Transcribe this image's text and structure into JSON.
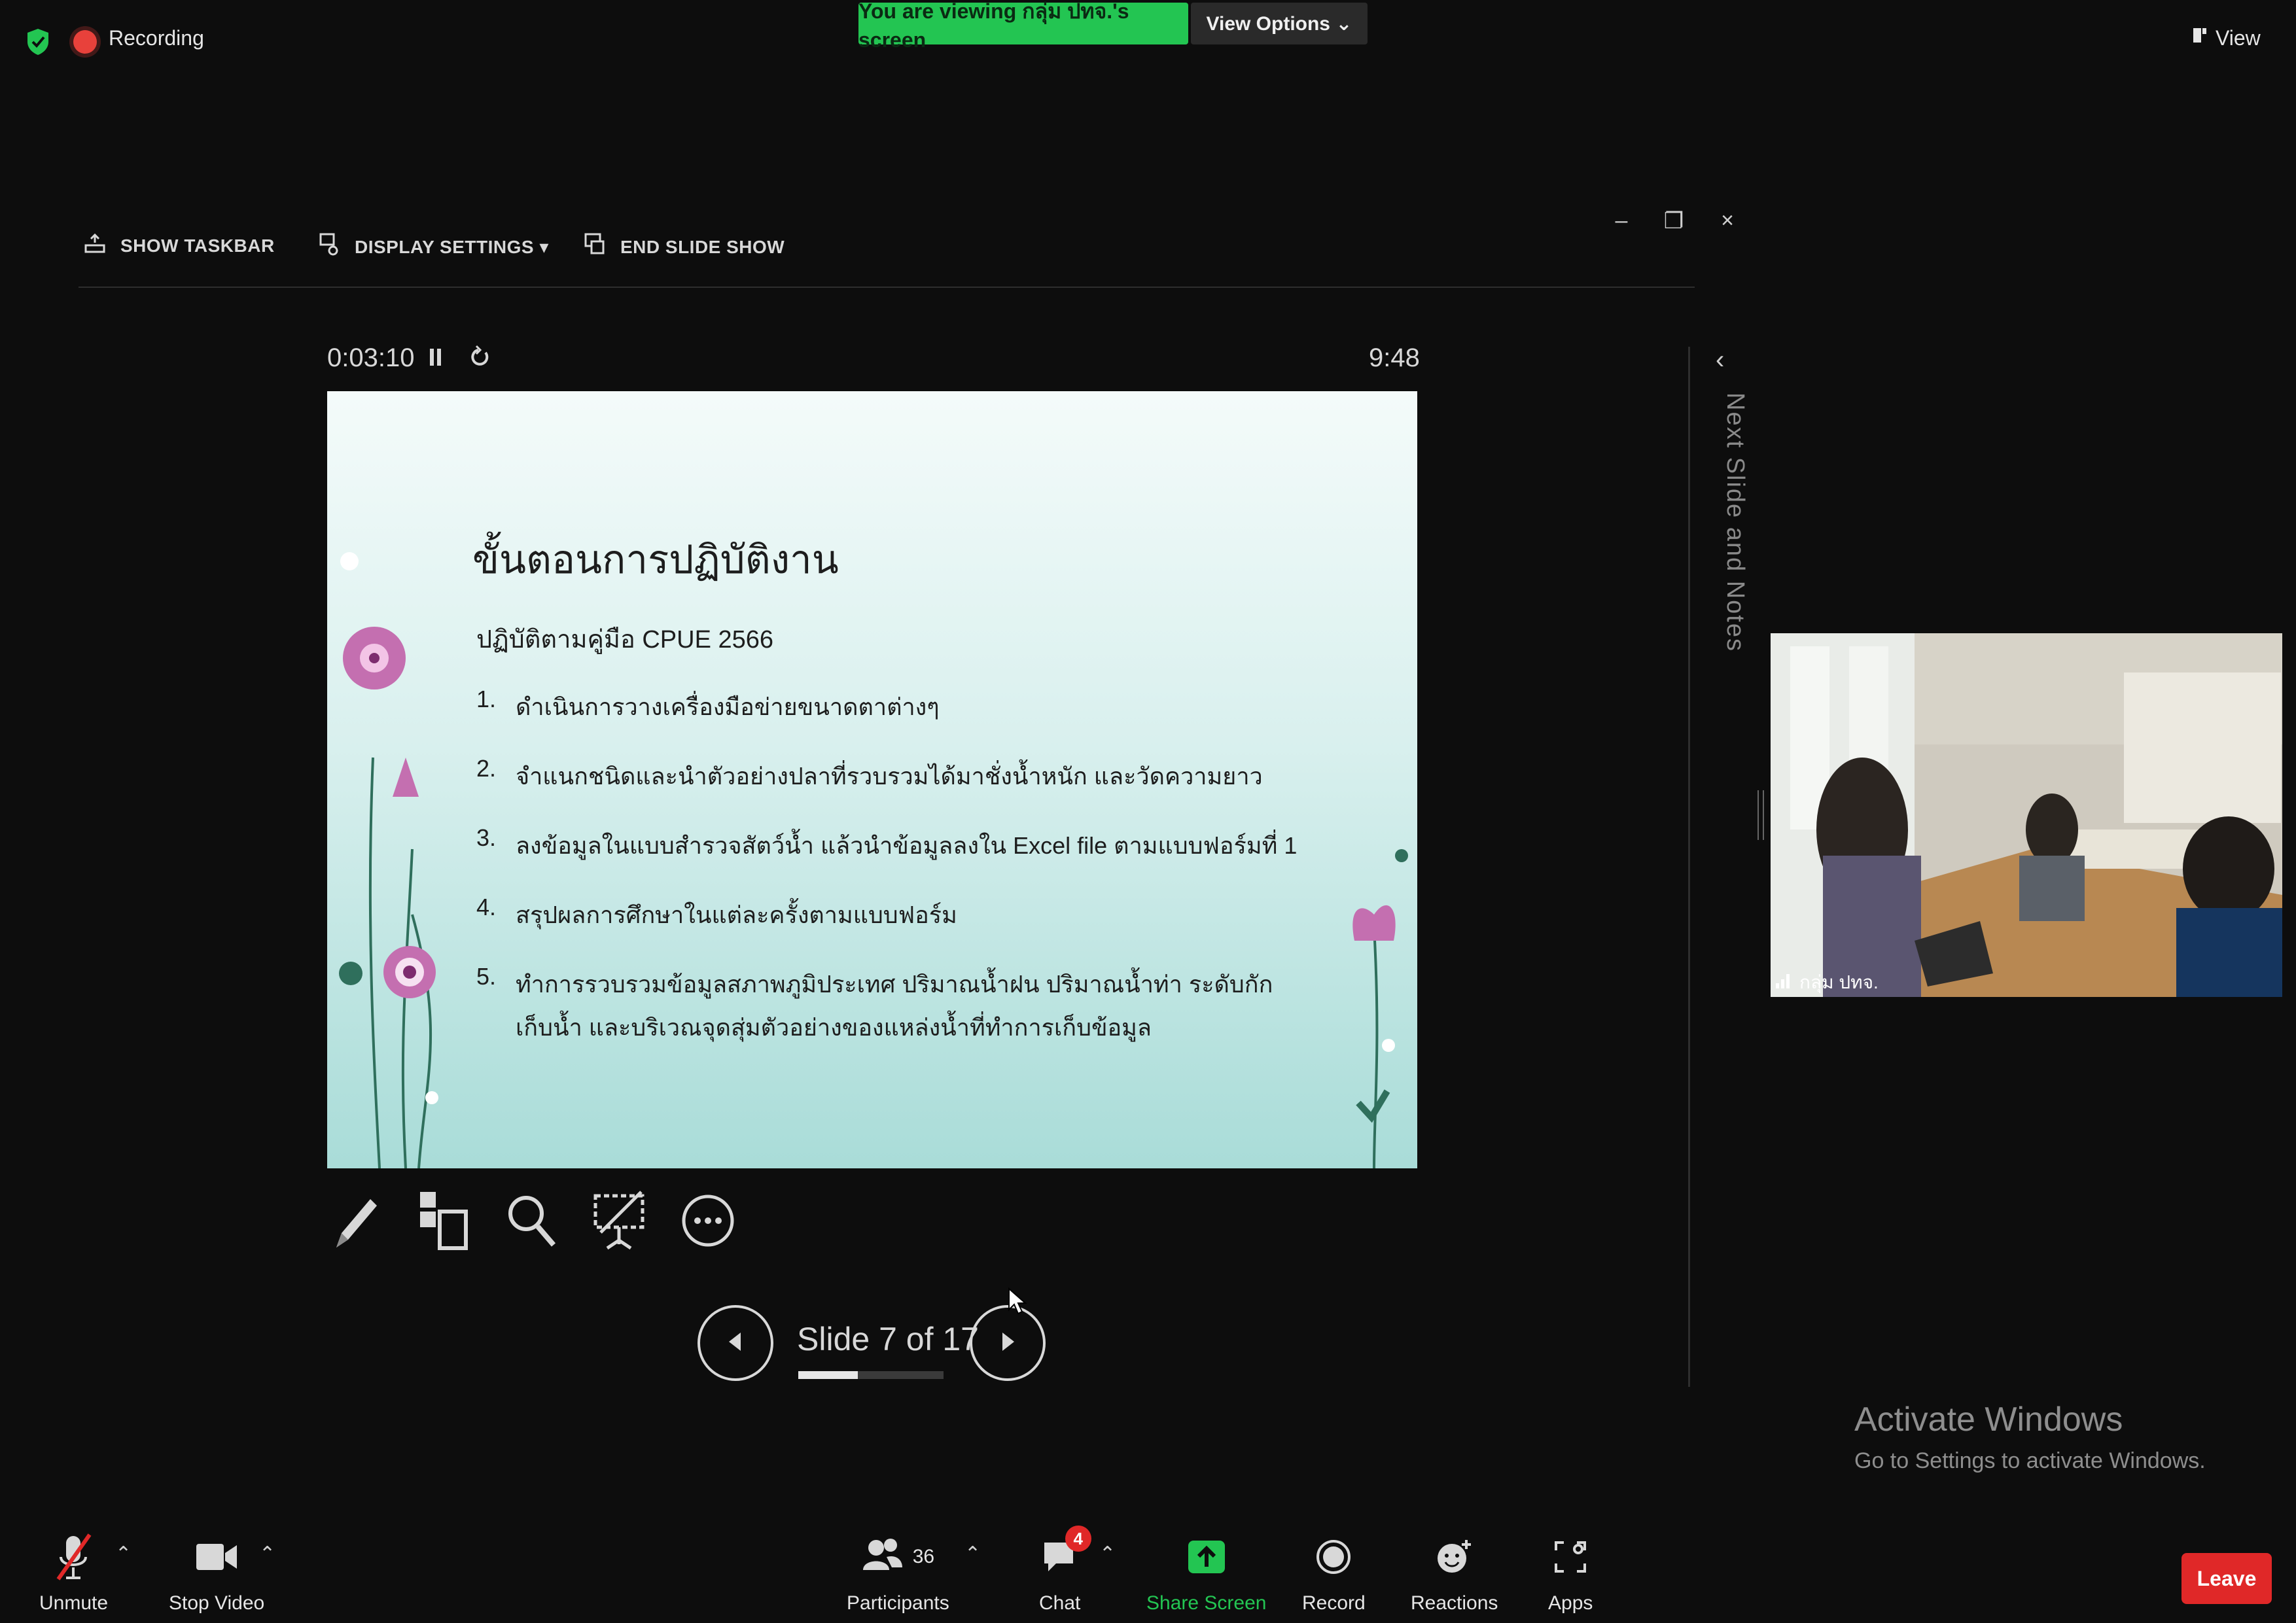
{
  "topbar": {
    "recording_label": "Recording",
    "viewing_banner": "You are viewing กลุ่ม ปทจ.'s screen",
    "view_options_label": "View Options ⌄",
    "view_label": "View"
  },
  "presenter": {
    "toolbar": {
      "show_taskbar": "SHOW TASKBAR",
      "display_settings": "DISPLAY SETTINGS ▾",
      "end_slide_show": "END SLIDE SHOW"
    },
    "window_controls": {
      "minimize": "–",
      "restore": "❐",
      "close": "×"
    },
    "elapsed_time": "0:03:10",
    "clock": "9:48",
    "next_slide_label": "Next Slide and Notes",
    "slide_counter": "Slide 7 of 17",
    "slide_progress": 0.41
  },
  "slide": {
    "title": "ขั้นตอนการปฏิบัติงาน",
    "subtitle": "ปฏิบัติตามคู่มือ CPUE 2566",
    "items": [
      {
        "num": "1.",
        "text": "ดำเนินการวางเครื่องมือข่ายขนาดตาต่างๆ"
      },
      {
        "num": "2.",
        "text": "จำแนกชนิดและนำตัวอย่างปลาที่รวบรวมได้มาชั่งน้ำหนัก และวัดความยาว"
      },
      {
        "num": "3.",
        "text": "ลงข้อมูลในแบบสำรวจสัตว์น้ำ แล้วนำข้อมูลลงใน Excel file ตามแบบฟอร์มที่ 1"
      },
      {
        "num": "4.",
        "text": "สรุปผลการศึกษาในแต่ละครั้งตามแบบฟอร์ม"
      },
      {
        "num": "5.",
        "text": "ทำการรวบรวมข้อมูลสภาพภูมิประเทศ ปริมาณน้ำฝน ปริมาณน้ำท่า ระดับกักเก็บน้ำ และบริเวณจุดสุ่มตัวอย่างของแหล่งน้ำที่ทำการเก็บข้อมูล"
      }
    ]
  },
  "video": {
    "participant_name": "กลุ่ม ปทจ."
  },
  "watermark": {
    "title": "Activate Windows",
    "subtitle": "Go to Settings to activate Windows."
  },
  "toolbar": {
    "unmute": "Unmute",
    "stop_video": "Stop Video",
    "participants": "Participants",
    "participants_count": "36",
    "chat": "Chat",
    "chat_badge": "4",
    "share_screen": "Share Screen",
    "record": "Record",
    "reactions": "Reactions",
    "apps": "Apps",
    "leave": "Leave"
  },
  "colors": {
    "share_green": "#23c552",
    "leave_red": "#e02828",
    "background": "#0d0d0d"
  }
}
